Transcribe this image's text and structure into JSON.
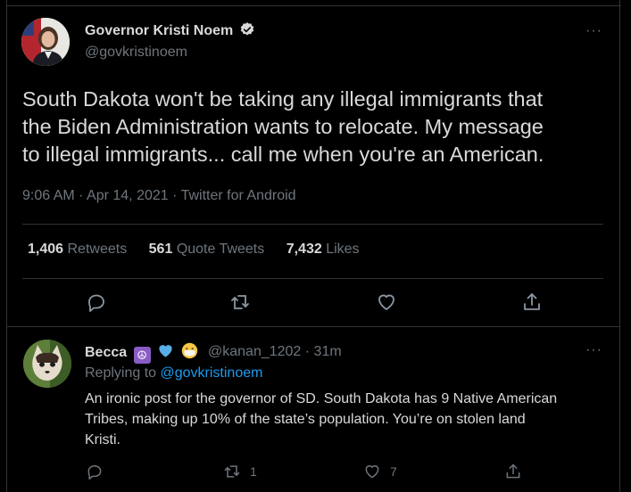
{
  "tweet": {
    "author_name": "Governor Kristi Noem",
    "author_handle": "@govkristinoem",
    "text_lines": [
      "South Dakota won't be taking any illegal immigrants that",
      "the Biden Administration wants to relocate. My message",
      "to illegal immigrants... call me when you're an American."
    ],
    "meta": "9:06 AM · Apr 14, 2021 · Twitter for Android",
    "stats": {
      "retweets_count": "1,406",
      "retweets_label": "Retweets",
      "quotes_count": "561",
      "quotes_label": "Quote Tweets",
      "likes_count": "7,432",
      "likes_label": "Likes"
    },
    "more_icon": "···"
  },
  "reply": {
    "author_name": "Becca",
    "emojis": [
      "peace-symbol",
      "blue-heart",
      "face-with-medical-mask"
    ],
    "author_handle": "@kanan_1202",
    "time": "· 31m",
    "replying_prefix": "Replying to",
    "replying_to": "@govkristinoem",
    "text_lines": [
      "An ironic post for the governor of SD. South Dakota has 9 Native American",
      "Tribes, making up 10% of the state’s population. You’re on stolen land",
      "Kristi."
    ],
    "retweet_count": "1",
    "like_count": "7",
    "more_icon": "···"
  },
  "colors": {
    "background": "#000000",
    "text": "#d9d9d9",
    "secondary": "#6e767d",
    "link": "#1d9bf0",
    "divider": "#2f3336"
  }
}
